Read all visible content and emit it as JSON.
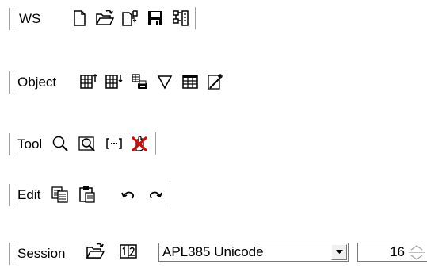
{
  "toolbars": {
    "ws": {
      "label": "WS",
      "buttons": [
        "new-ws-icon",
        "open-ws-icon",
        "copy-ws-icon",
        "save-ws-icon",
        "explorer-icon"
      ]
    },
    "object": {
      "label": "Object",
      "buttons": [
        "insert-object-above-icon",
        "insert-object-below-icon",
        "print-object-icon",
        "filter-icon",
        "spreadsheet-icon",
        "wizard-icon"
      ]
    },
    "tool": {
      "label": "Tool",
      "buttons": [
        "find-icon",
        "find-replace-icon",
        "line-numbers-icon",
        "clear-stops-icon"
      ]
    },
    "edit": {
      "label": "Edit",
      "buttons": [
        "copy-icon",
        "paste-icon",
        "undo-icon",
        "redo-icon"
      ]
    },
    "session": {
      "label": "Session",
      "font_value": "APL385 Unicode",
      "size_value": "16"
    }
  }
}
